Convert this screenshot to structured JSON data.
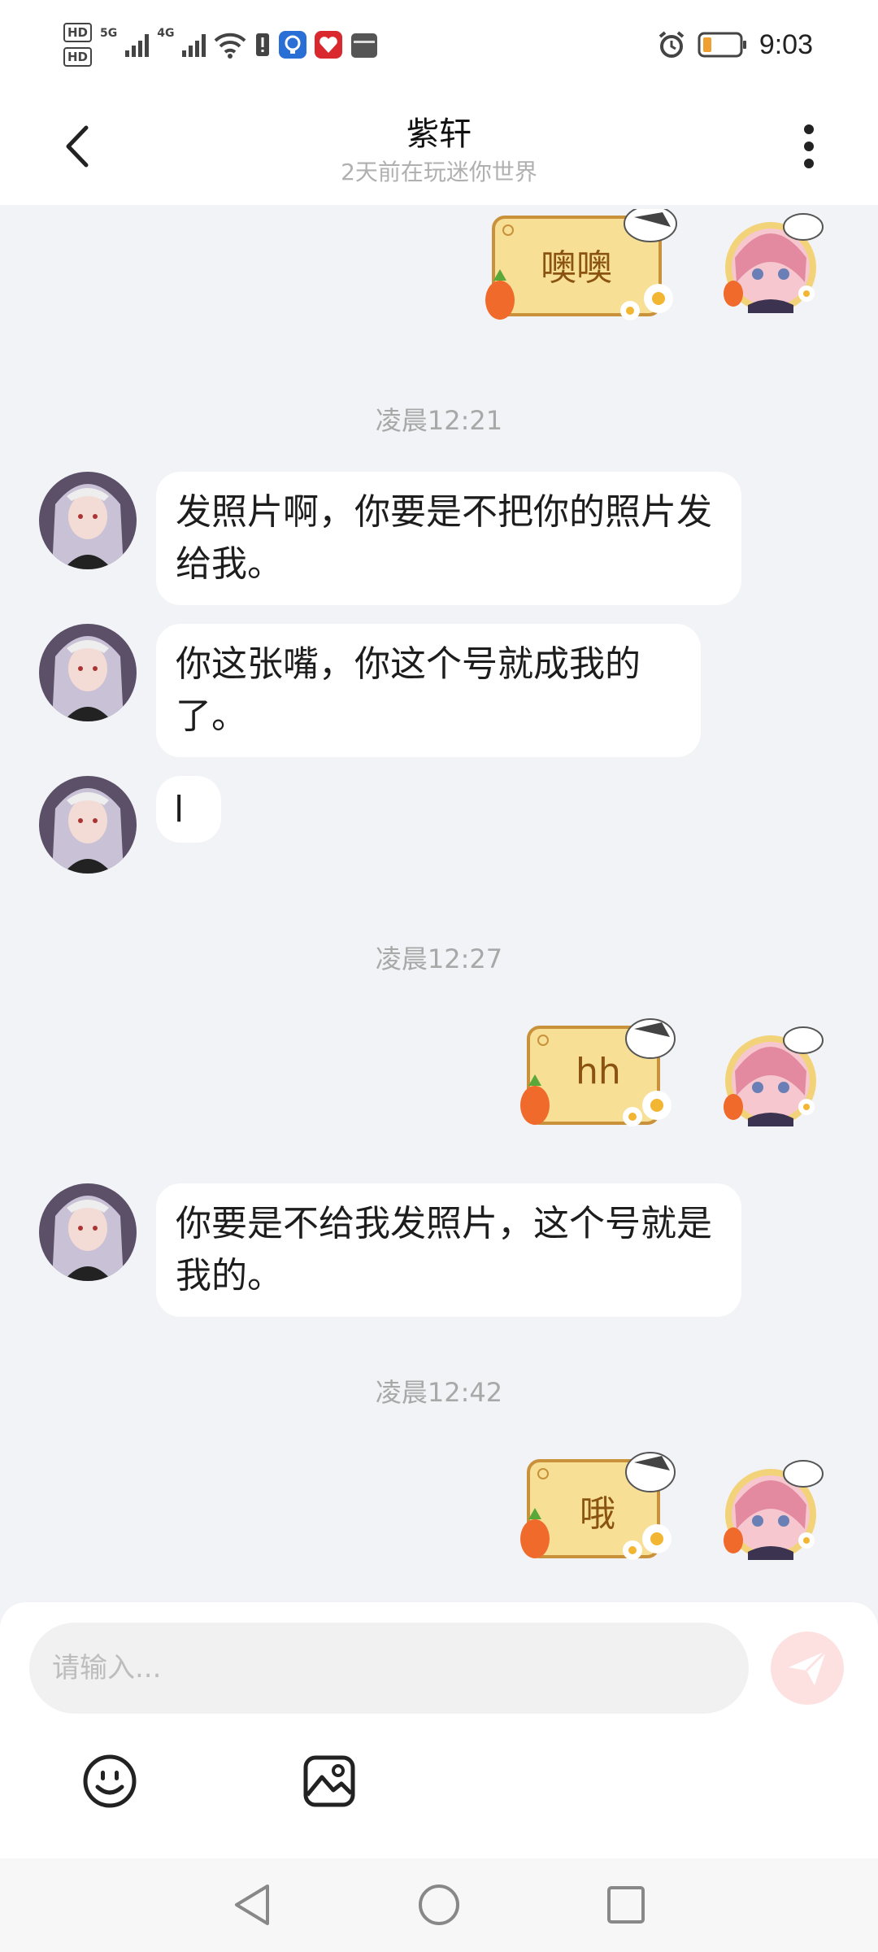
{
  "status_bar": {
    "hd1": "HD",
    "hd2": "HD",
    "net1": "5G",
    "net2": "4G",
    "time": "9:03"
  },
  "header": {
    "title": "紫轩",
    "subtitle": "2天前在玩迷你世界"
  },
  "messages": {
    "sticker1": "噢噢",
    "time1": "凌晨12:21",
    "msg1": "发照片啊，你要是不把你的照片发给我。",
    "msg2": "你这张嘴，你这个号就成我的了。",
    "msg3": "l",
    "time2": "凌晨12:27",
    "sticker2": "hh",
    "msg4": "你要是不给我发照片，这个号就是我的。",
    "time3": "凌晨12:42",
    "sticker3": "哦"
  },
  "input": {
    "placeholder": "请输入..."
  },
  "icons": {
    "back": "chevron-left-icon",
    "more": "more-vertical-icon",
    "send": "send-icon",
    "emoji": "emoji-icon",
    "image": "image-icon",
    "nav_back": "triangle-back-icon",
    "nav_home": "circle-home-icon",
    "nav_recent": "square-recent-icon"
  },
  "colors": {
    "background": "#f2f3f6",
    "bubble": "#ffffff",
    "sticker_fill": "#f7df95",
    "sticker_border": "#c9923a",
    "sticker_text": "#8a5410",
    "send_button": "#fde1e1",
    "timestamp": "#a8a8a8"
  }
}
